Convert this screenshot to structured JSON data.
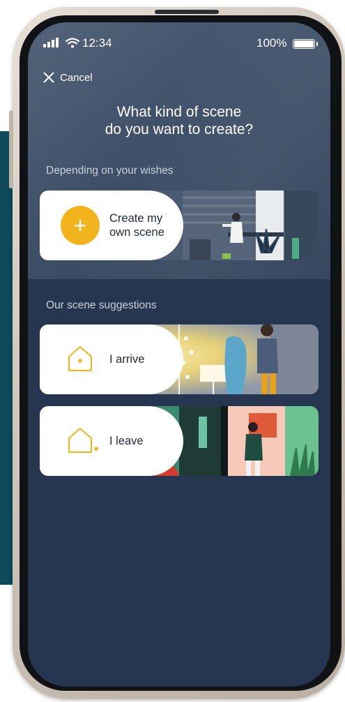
{
  "status_bar": {
    "time": "12:34",
    "battery": "100%"
  },
  "header": {
    "cancel_label": "Cancel",
    "title_line1": "What kind of scene",
    "title_line2": "do you want to create?"
  },
  "create_section": {
    "label": "Depending on your wishes",
    "create_card_line1": "Create my",
    "create_card_line2": "own scene",
    "plus_icon": "+"
  },
  "suggestions": {
    "label": "Our scene suggestions",
    "items": [
      {
        "label": "I arrive",
        "icon": "home-arrive-icon"
      },
      {
        "label": "I leave",
        "icon": "home-leave-icon"
      }
    ]
  },
  "colors": {
    "accent": "#f2b41d",
    "background": "#263650",
    "header_background": "#3e5068",
    "card_background": "#ffffff",
    "text_dark": "#1f2a3b"
  }
}
